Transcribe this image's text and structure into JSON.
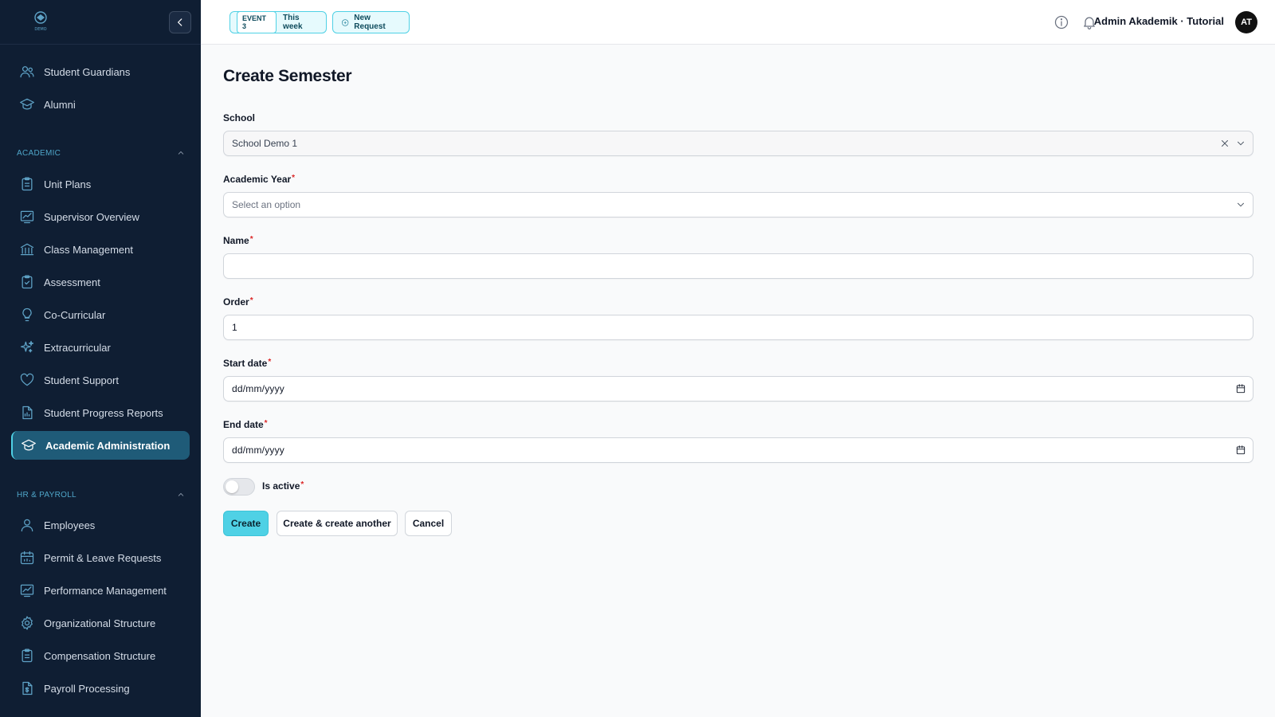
{
  "topbar": {
    "event_tag": "EVENT 3",
    "event_period": "This week",
    "new_request": "New Request",
    "user_name": "Admin Akademik · Tutorial",
    "avatar_initials": "AT"
  },
  "sidebar": {
    "logo_text": "DEMO",
    "items_top": [
      {
        "label": "Student Guardians",
        "icon": "users-icon"
      },
      {
        "label": "Alumni",
        "icon": "graduation-cap-icon"
      }
    ],
    "section_academic": "ACADEMIC",
    "items_academic": [
      {
        "label": "Unit Plans",
        "icon": "clipboard-icon"
      },
      {
        "label": "Supervisor Overview",
        "icon": "chart-line-icon"
      },
      {
        "label": "Class Management",
        "icon": "building-columns-icon"
      },
      {
        "label": "Assessment",
        "icon": "clipboard-check-icon"
      },
      {
        "label": "Co-Curricular",
        "icon": "lightbulb-icon"
      },
      {
        "label": "Extracurricular",
        "icon": "sparkles-icon"
      },
      {
        "label": "Student Support",
        "icon": "heart-icon"
      },
      {
        "label": "Student Progress Reports",
        "icon": "document-chart-icon"
      },
      {
        "label": "Academic Administration",
        "icon": "graduation-cap-icon",
        "active": true
      }
    ],
    "section_hr": "HR & PAYROLL",
    "items_hr": [
      {
        "label": "Employees",
        "icon": "user-icon"
      },
      {
        "label": "Permit & Leave Requests",
        "icon": "calendar-icon"
      },
      {
        "label": "Performance Management",
        "icon": "chart-line-icon"
      },
      {
        "label": "Organizational Structure",
        "icon": "gear-icon"
      },
      {
        "label": "Compensation Structure",
        "icon": "clipboard-icon"
      },
      {
        "label": "Payroll Processing",
        "icon": "document-dollar-icon"
      }
    ]
  },
  "form": {
    "title": "Create Semester",
    "school_label": "School",
    "school_value": "School Demo 1",
    "academic_year_label": "Academic Year",
    "academic_year_placeholder": "Select an option",
    "name_label": "Name",
    "name_value": "",
    "order_label": "Order",
    "order_value": "1",
    "start_date_label": "Start date",
    "start_date_placeholder": "dd/mm/yyyy",
    "end_date_label": "End date",
    "end_date_placeholder": "dd/mm/yyyy",
    "is_active_label": "Is active",
    "required_mark": "*",
    "create_button": "Create",
    "create_another_button": "Create & create another",
    "cancel_button": "Cancel"
  },
  "colors": {
    "sidebar_bg": "#0f1e33",
    "accent": "#4fd1e5",
    "active_item_bg": "#1f5b78",
    "required": "#dc2626"
  }
}
